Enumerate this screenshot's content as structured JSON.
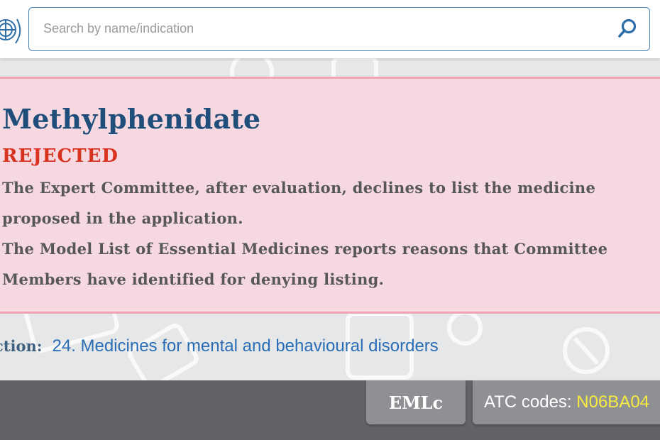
{
  "search": {
    "placeholder": "Search by name/indication",
    "button_icon": "search-icon"
  },
  "medicine": {
    "name": "Methylphenidate",
    "status": "REJECTED",
    "description": [
      "The Expert Committee, after evaluation, declines to list the medicine",
      "proposed in the application.",
      "The Model List of Essential Medicines reports reasons that Committee",
      "Members have identified for denying listing."
    ]
  },
  "section": {
    "label": "ction:",
    "value": "24. Medicines for mental and behavioural disorders"
  },
  "footer": {
    "eml_label": "EMLc",
    "atc_label": "ATC codes:",
    "atc_code": "N06BA04"
  },
  "colors": {
    "title": "#1f4e7a",
    "rejected": "#d8331f",
    "rejected_box_bg": "#f5d8e0",
    "rejected_box_border": "#eda5b6",
    "link": "#2a6db4",
    "footer_bg": "#626366",
    "atc_code": "#f7ec40"
  }
}
